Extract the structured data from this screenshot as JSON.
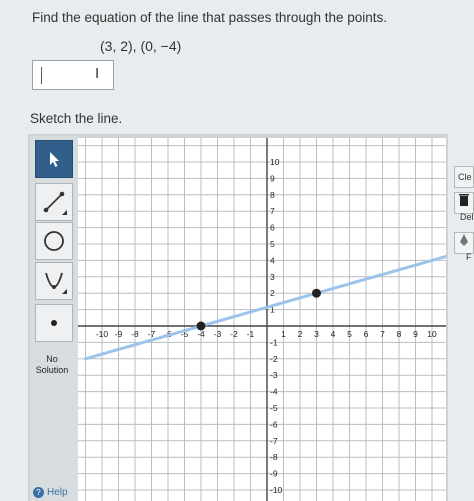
{
  "question": {
    "prompt": "Find the equation of the line that passes through the points.",
    "points_text": "(3, 2), (0, −4)"
  },
  "answer": {
    "value": "",
    "cursor_icon": "I"
  },
  "sketch_label": "Sketch the line.",
  "tools": [
    {
      "name": "pointer-tool",
      "icon": "arrow-pointer-icon",
      "active": true
    },
    {
      "name": "line-tool",
      "icon": "line-segment-icon",
      "active": false
    },
    {
      "name": "circle-tool",
      "icon": "circle-icon",
      "active": false
    },
    {
      "name": "parabola-tool",
      "icon": "parabola-icon",
      "active": false
    },
    {
      "name": "point-tool",
      "icon": "point-icon",
      "active": false
    }
  ],
  "no_solution": {
    "line1": "No",
    "line2": "Solution"
  },
  "help_label": "Help",
  "side_buttons": {
    "clear": "Cle",
    "delete": "Del",
    "fill": "F"
  },
  "chart_data": {
    "type": "line",
    "xlim": [
      -10,
      10
    ],
    "ylim": [
      -10,
      10
    ],
    "grid": true,
    "x_tick_labels": [
      "-10",
      "-9",
      "-8",
      "-7",
      "-6",
      "-5",
      "-4",
      "-3",
      "-2",
      "-1",
      "1",
      "2",
      "3",
      "4",
      "5",
      "6",
      "7",
      "8",
      "9",
      "10"
    ],
    "y_tick_labels": [
      "10",
      "9",
      "8",
      "7",
      "6",
      "5",
      "4",
      "3",
      "2",
      "1",
      "-1",
      "-2",
      "-3",
      "-4",
      "-5",
      "-6",
      "-7",
      "-8",
      "-9",
      "-10"
    ],
    "points": [
      {
        "x": -4,
        "y": 0
      },
      {
        "x": 3,
        "y": 2
      }
    ],
    "line": {
      "through": [
        [
          -4,
          0
        ],
        [
          3,
          2
        ]
      ],
      "color": "#9cc4ea"
    },
    "colors": {
      "grid": "#b9bec2",
      "axis": "#444444",
      "point": "#222222",
      "background": "#ffffff"
    }
  }
}
